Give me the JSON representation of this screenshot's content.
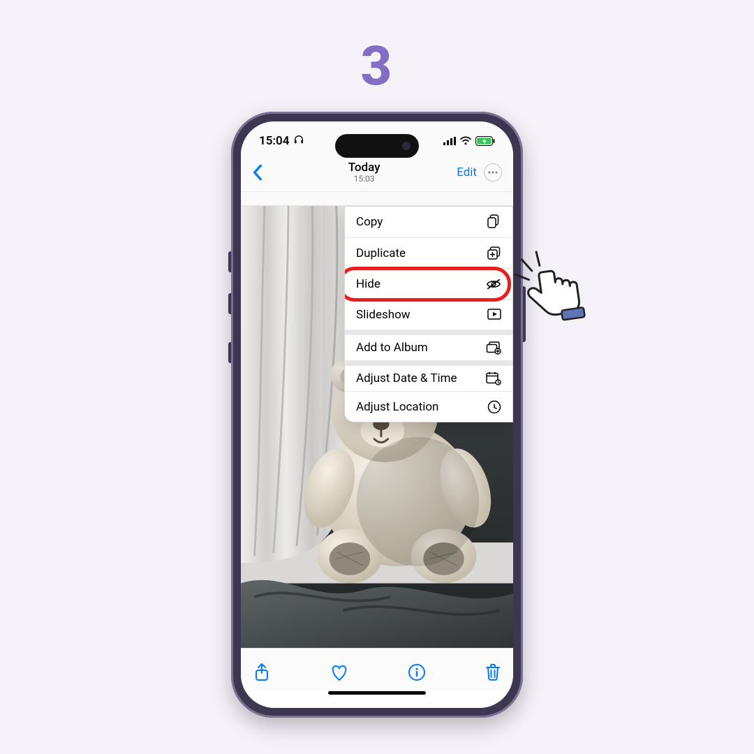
{
  "step_number": "3",
  "statusbar": {
    "time": "15:04"
  },
  "nav": {
    "title": "Today",
    "subtitle": "15:03",
    "edit_label": "Edit"
  },
  "menu": {
    "items": [
      {
        "label": "Copy",
        "icon": "copy-icon"
      },
      {
        "label": "Duplicate",
        "icon": "duplicate-icon"
      },
      {
        "label": "Hide",
        "icon": "hide-icon"
      },
      {
        "label": "Slideshow",
        "icon": "slideshow-icon"
      },
      {
        "label": "Add to Album",
        "icon": "add-album-icon"
      },
      {
        "label": "Adjust Date & Time",
        "icon": "adjust-date-icon"
      },
      {
        "label": "Adjust Location",
        "icon": "adjust-location-icon"
      }
    ],
    "highlighted_index": 2
  },
  "colors": {
    "ios_blue": "#007aff",
    "highlight_red": "#e81f1f",
    "step_purple": "#826ec5"
  }
}
